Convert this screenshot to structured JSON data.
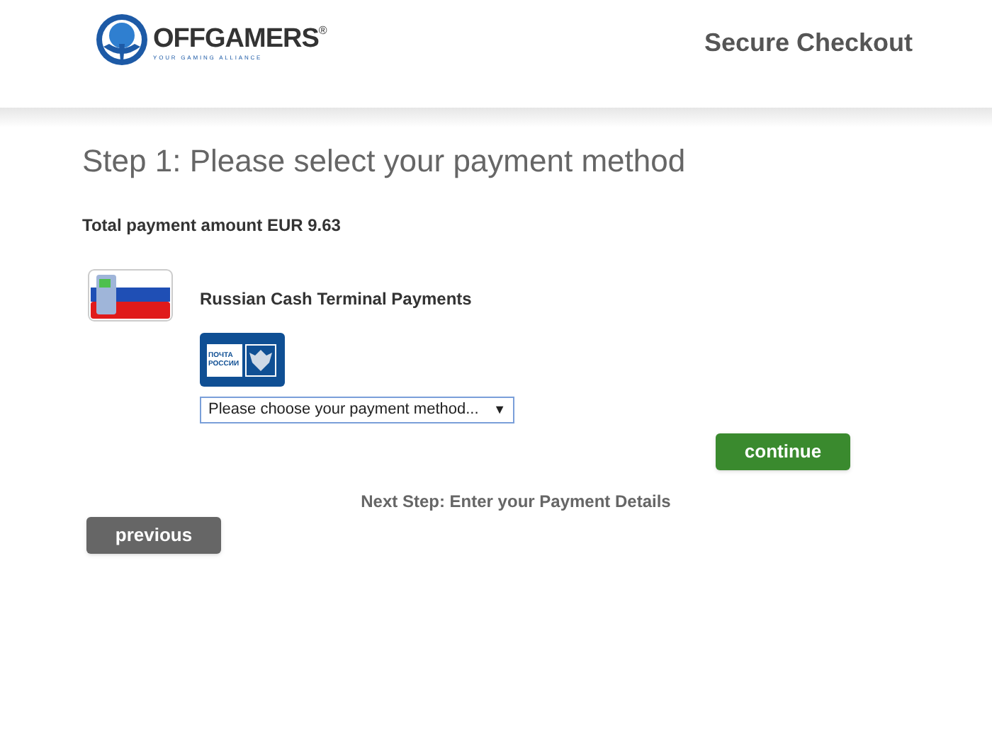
{
  "header": {
    "brand": "OFFGAMERS",
    "registered": "®",
    "tagline": "YOUR GAMING ALLIANCE",
    "title": "Secure Checkout"
  },
  "heading": "Step 1: Please select your payment method",
  "total": "Total payment amount EUR 9.63",
  "payment_method": {
    "name": "Russian Cash Terminal Payments",
    "provider_logo": "ПОЧТА РОССИИ",
    "select": {
      "value": "Please choose your payment method...",
      "arrow": "▼"
    }
  },
  "buttons": {
    "continue": "continue",
    "previous": "previous"
  },
  "next_step": "Next Step: Enter your Payment Details"
}
